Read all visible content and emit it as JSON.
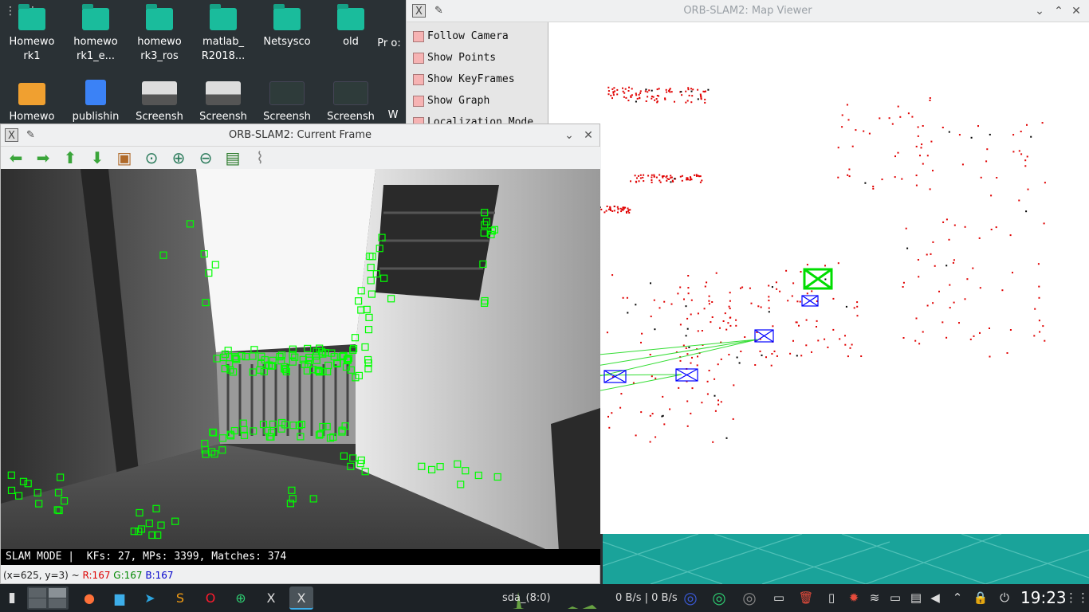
{
  "desktop": {
    "icons_row1": [
      {
        "label": "Homewo rk1"
      },
      {
        "label": "homewo rk1_e..."
      },
      {
        "label": "homewo rk3_ros"
      },
      {
        "label": "matlab_ R2018..."
      },
      {
        "label": "Netsysco"
      },
      {
        "label": "old"
      },
      {
        "label": "Pr o:"
      }
    ],
    "icons_row2": [
      {
        "label": "Homewo"
      },
      {
        "label": "publishin"
      },
      {
        "label": "Screensh"
      },
      {
        "label": "Screensh"
      },
      {
        "label": "Screensh"
      },
      {
        "label": "Screensh"
      },
      {
        "label": "W"
      }
    ]
  },
  "map_viewer": {
    "title": "ORB-SLAM2: Map Viewer",
    "options": [
      {
        "label": "Follow Camera"
      },
      {
        "label": "Show Points"
      },
      {
        "label": "Show KeyFrames"
      },
      {
        "label": "Show Graph"
      },
      {
        "label": "Localization Mode"
      }
    ]
  },
  "current_frame": {
    "title": "ORB-SLAM2: Current Frame",
    "toolbar": [
      "back-arrow",
      "forward-arrow",
      "up-arrow",
      "down-arrow",
      "picture",
      "zoom-fit",
      "zoom-in",
      "zoom-out",
      "save",
      "clear"
    ],
    "status": "SLAM MODE |  KFs: 27, MPs: 3399, Matches: 374",
    "pixel_info": {
      "coords": "(x=625, y=3) ~",
      "r": "R:167",
      "g": "G:167",
      "b": "B:167"
    }
  },
  "taskbar": {
    "disk_label": "sda_(8:0)",
    "net_rate": "0 B/s | 0 B/s",
    "clock": "19:23"
  },
  "colors": {
    "feature": "#00ff00",
    "map_point": "#e00000",
    "keyframe": "#0000ff",
    "accent": "#3daee9"
  }
}
